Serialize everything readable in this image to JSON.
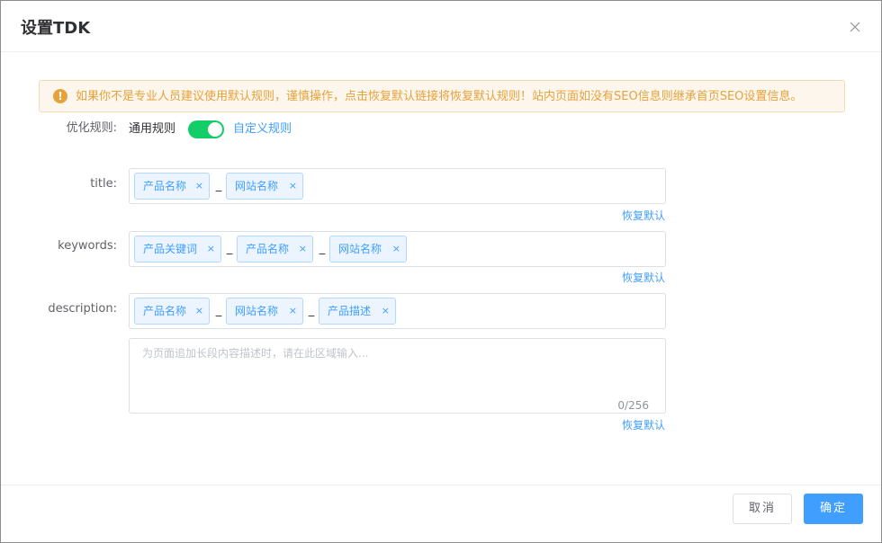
{
  "dialog": {
    "title": "设置TDK",
    "close_icon": "close-icon"
  },
  "alert": {
    "icon": "warning-icon",
    "icon_glyph": "!",
    "text": "如果你不是专业人员建议使用默认规则，谨慎操作，点击恢复默认链接将恢复默认规则！站内页面如没有SEO信息则继承首页SEO设置信息。"
  },
  "rule": {
    "label": "优化规则:",
    "option_general": "通用规则",
    "option_custom": "自定义规则",
    "switch_on": true
  },
  "title_field": {
    "label": "title:",
    "tags": [
      "产品名称",
      "网站名称"
    ],
    "separator": "_",
    "restore": "恢复默认"
  },
  "keywords_field": {
    "label": "keywords:",
    "tags": [
      "产品关键词",
      "产品名称",
      "网站名称"
    ],
    "separator": "_",
    "restore": "恢复默认"
  },
  "description_field": {
    "label": "description:",
    "tags": [
      "产品名称",
      "网站名称",
      "产品描述"
    ],
    "separator": "_",
    "textarea_placeholder": "为页面追加长段内容描述时，请在此区域输入...",
    "counter": "0/256",
    "restore": "恢复默认"
  },
  "tag_close_glyph": "×",
  "footer": {
    "cancel": "取消",
    "confirm": "确定"
  },
  "colors": {
    "primary": "#409eff",
    "warning": "#e6a23c",
    "switch_on": "#13ce66"
  }
}
